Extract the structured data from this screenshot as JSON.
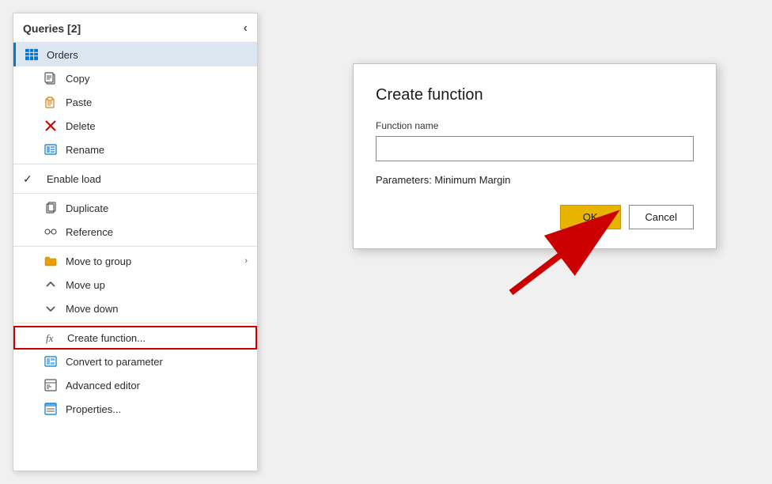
{
  "panel": {
    "title": "Queries [2]",
    "collapse_icon": "‹",
    "active_item": "Orders"
  },
  "menu_items": [
    {
      "id": "orders",
      "label": "Orders",
      "icon_type": "table",
      "active": true,
      "indent": 0
    },
    {
      "id": "copy",
      "label": "Copy",
      "icon_type": "copy",
      "active": false,
      "indent": 1
    },
    {
      "id": "paste",
      "label": "Paste",
      "icon_type": "paste",
      "active": false,
      "indent": 1
    },
    {
      "id": "delete",
      "label": "Delete",
      "icon_type": "delete",
      "active": false,
      "indent": 1
    },
    {
      "id": "rename",
      "label": "Rename",
      "icon_type": "rename",
      "active": false,
      "indent": 1
    },
    {
      "id": "enable-load",
      "label": "Enable load",
      "icon_type": "check",
      "active": false,
      "indent": 0,
      "has_check": true
    },
    {
      "id": "duplicate",
      "label": "Duplicate",
      "icon_type": "duplicate",
      "active": false,
      "indent": 1
    },
    {
      "id": "reference",
      "label": "Reference",
      "icon_type": "reference",
      "active": false,
      "indent": 1
    },
    {
      "id": "move-to-group",
      "label": "Move to group",
      "icon_type": "folder",
      "active": false,
      "indent": 1,
      "has_arrow": true
    },
    {
      "id": "move-up",
      "label": "Move up",
      "icon_type": "moveup",
      "active": false,
      "indent": 1
    },
    {
      "id": "move-down",
      "label": "Move down",
      "icon_type": "movedown",
      "active": false,
      "indent": 1
    },
    {
      "id": "create-function",
      "label": "Create function...",
      "icon_type": "fx",
      "active": false,
      "indent": 1,
      "highlighted": true
    },
    {
      "id": "convert-to-parameter",
      "label": "Convert to parameter",
      "icon_type": "convert",
      "active": false,
      "indent": 1
    },
    {
      "id": "advanced-editor",
      "label": "Advanced editor",
      "icon_type": "editor",
      "active": false,
      "indent": 1
    },
    {
      "id": "properties",
      "label": "Properties...",
      "icon_type": "properties",
      "active": false,
      "indent": 1
    }
  ],
  "dialog": {
    "title": "Create function",
    "function_name_label": "Function name",
    "function_name_placeholder": "",
    "params_label": "Parameters: Minimum Margin",
    "ok_label": "OK",
    "cancel_label": "Cancel"
  }
}
